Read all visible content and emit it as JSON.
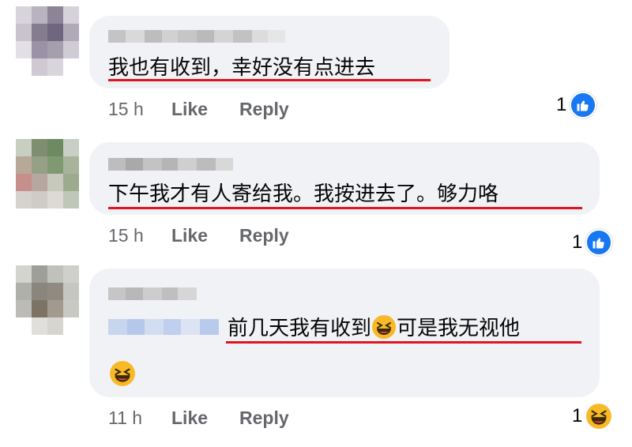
{
  "comments": [
    {
      "text": "我也有收到，幸好没有点进去",
      "time": "15 h",
      "like_label": "Like",
      "reply_label": "Reply",
      "reaction_count": "1",
      "reaction_icon": "like-icon"
    },
    {
      "text": "下午我才有人寄给我。我按进去了。够力咯",
      "time": "15 h",
      "like_label": "Like",
      "reply_label": "Reply",
      "reaction_count": "1",
      "reaction_icon": "like-icon"
    },
    {
      "text": "前几天我有收到",
      "text_after_emoji": "可是我无视他",
      "emoji": "grinning-squinting-face-emoji",
      "time": "11 h",
      "like_label": "Like",
      "reply_label": "Reply",
      "reaction_count": "1",
      "reaction_icon": "haha-icon"
    }
  ],
  "colors": {
    "bubble": "#f0f2f5",
    "underline": "#e0141e",
    "meta_text": "#65676b",
    "like_blue": "#1877f2",
    "haha_yellow": "#f7b928"
  }
}
